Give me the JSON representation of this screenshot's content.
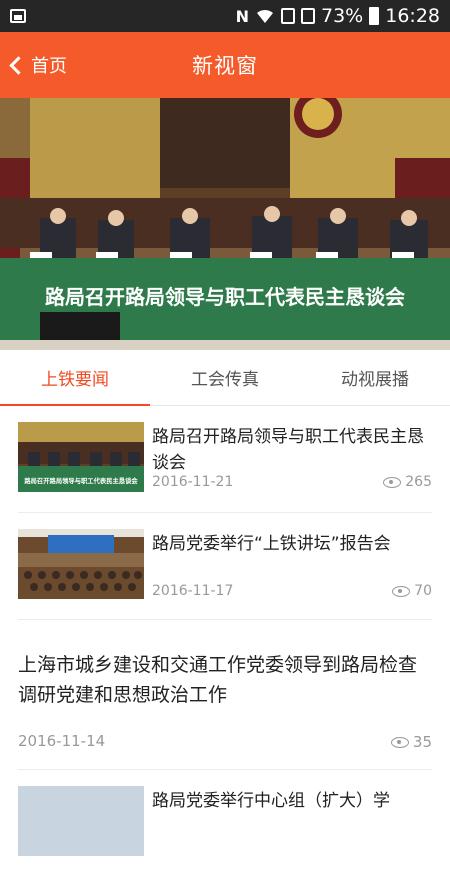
{
  "status_bar": {
    "battery": "73%",
    "time": "16:28",
    "nfc_glyph": "N"
  },
  "nav": {
    "back_label": "首页",
    "title": "新视窗"
  },
  "banner": {
    "caption": "路局召开路局领导与职工代表民主恳谈会"
  },
  "tabs": [
    {
      "label": "上铁要闻",
      "active": true
    },
    {
      "label": "工会传真",
      "active": false
    },
    {
      "label": "动视展播",
      "active": false
    }
  ],
  "news": [
    {
      "title": "路局召开路局领导与职工代表民主恳谈会",
      "date": "2016-11-21",
      "views": "265",
      "thumb_caption": "路局召开路局领导与职工代表民主恳谈会"
    },
    {
      "title": "路局党委举行“上铁讲坛”报告会",
      "date": "2016-11-17",
      "views": "70"
    },
    {
      "title": "上海市城乡建设和交通工作党委领导到路局检查调研党建和思想政治工作",
      "date": "2016-11-14",
      "views": "35"
    },
    {
      "title": "路局党委举行中心组（扩大）学"
    }
  ]
}
